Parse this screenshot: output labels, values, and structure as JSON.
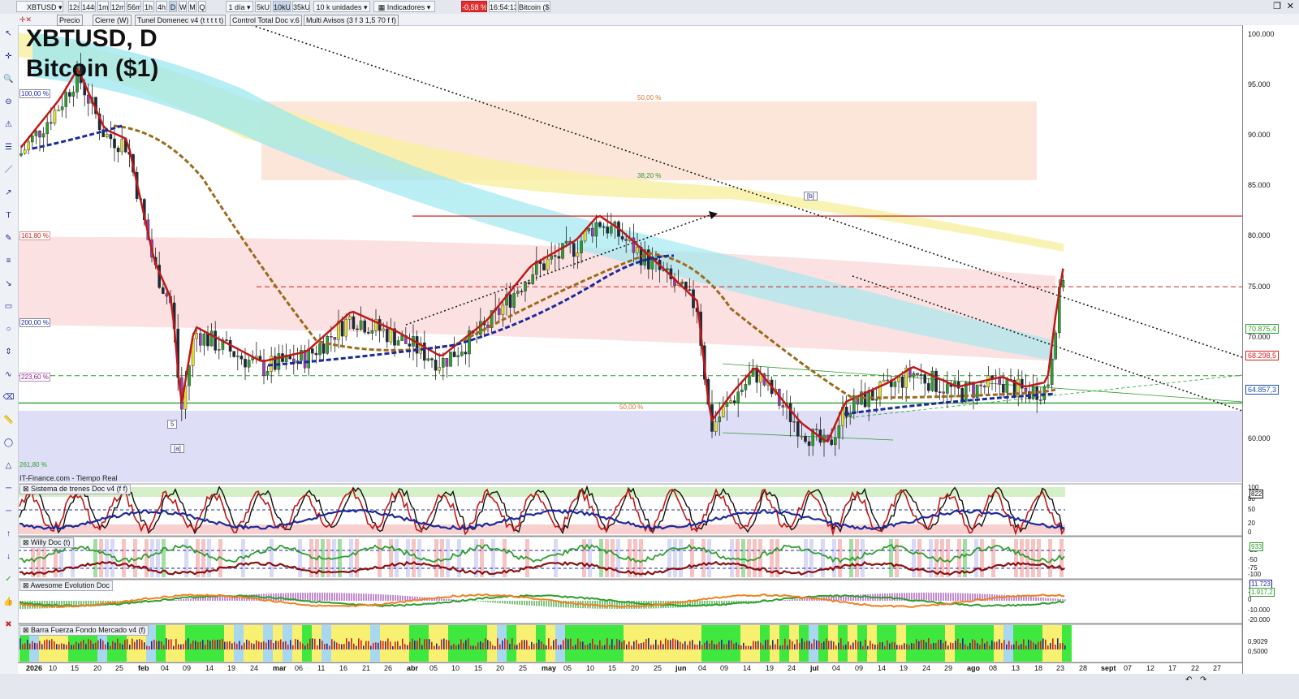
{
  "toolbar": {
    "symbol": "XBTUSD",
    "intervals": [
      "12s",
      "144s",
      "1m",
      "12m",
      "56m",
      "1h",
      "4h",
      "D",
      "W",
      "M",
      "Q"
    ],
    "selected_interval": "D",
    "range": "1 día",
    "units_buttons": [
      "5kU",
      "10kU",
      "35kU"
    ],
    "selected_units": "10kU",
    "units_select": "10 k unidades",
    "indicators_label": "Indicadores",
    "change": "-0,58 %",
    "time": "16:54:13",
    "instrument": "Bitcoin ($1)",
    "accent_negative": "#e03030"
  },
  "indicator_bar": {
    "items": [
      "Precio",
      "Cierre (W)",
      "Tunel Domenec v4 (t t t t t)",
      "Control Total Doc v.6",
      "Multi Avisos (3 f 3 1,5 70 f f)"
    ]
  },
  "chart_title": {
    "line1": "XBTUSD, D",
    "line2": "Bitcoin ($1)"
  },
  "source_label": "IT-Finance.com - Tiempo Real",
  "annotations": {
    "fib_labels": [
      "100,00 %",
      "161,80 %",
      "200,00 %",
      "223,60 %",
      "261,80 %",
      "50,00 %",
      "38,20 %",
      "50,00 %"
    ],
    "wave_labels": [
      "5",
      "[a]",
      "[b]"
    ]
  },
  "price_axis": {
    "ticks": [
      "100.000",
      "95.000",
      "90.000",
      "85.000",
      "80.000",
      "75.000",
      "70.000",
      "65.000",
      "60.000"
    ],
    "markers": [
      {
        "label": "70.875,4",
        "color": "#2e9e2e"
      },
      {
        "label": "68.298,5",
        "color": "#d02020"
      },
      {
        "label": "64.857,3",
        "color": "#2050b0"
      }
    ]
  },
  "panels": [
    {
      "title": "Sistema de trenes Doc v4 (f f)",
      "ticks": [
        "100",
        "80",
        "50",
        "20",
        "0"
      ],
      "marker": "822"
    },
    {
      "title": "Willy Doc (t)",
      "ticks": [
        "-25",
        "-50",
        "-75",
        "-100"
      ],
      "marker": "933"
    },
    {
      "title": "Awesome Evolution Doc",
      "ticks": [
        "10.000",
        "0",
        "-10.000",
        "-20.000"
      ],
      "markers": [
        "11.723",
        "1.917,2"
      ]
    },
    {
      "title": "Barra Fuerza Fondo Mercado v4 (f)",
      "ticks": [
        "0,9029",
        "0,5000"
      ]
    }
  ],
  "time_axis": [
    "2026",
    "10",
    "15",
    "20",
    "25",
    "feb",
    "04",
    "09",
    "14",
    "19",
    "24",
    "mar",
    "06",
    "11",
    "16",
    "21",
    "26",
    "abr",
    "05",
    "10",
    "15",
    "20",
    "25",
    "may",
    "05",
    "10",
    "15",
    "20",
    "25",
    "jun",
    "04",
    "09",
    "14",
    "19",
    "24",
    "jul",
    "04",
    "09",
    "14",
    "19",
    "24",
    "29",
    "ago",
    "08",
    "13",
    "18",
    "23",
    "28",
    "sept",
    "07",
    "12",
    "17",
    "22",
    "27"
  ],
  "colors": {
    "up": "#2e9e2e",
    "down": "#c01818",
    "fib_pink": "#f8c8c8",
    "cloud_cyan": "#9ee8f0",
    "cloud_yellow": "#f8f0a0",
    "support_blue": "#d8d8f4"
  },
  "chart_data": {
    "type": "candlestick",
    "title": "XBTUSD, D",
    "subtitle": "Bitcoin ($1)",
    "ylim": [
      55000,
      103000
    ],
    "x_range": [
      "2026-01-01",
      "2026-09-30"
    ],
    "close_path": [
      {
        "date": "2026-01-01",
        "close": 88000
      },
      {
        "date": "2026-01-10",
        "close": 93000
      },
      {
        "date": "2026-01-14",
        "close": 96000
      },
      {
        "date": "2026-01-20",
        "close": 90000
      },
      {
        "date": "2026-01-25",
        "close": 89000
      },
      {
        "date": "2026-01-31",
        "close": 77000
      },
      {
        "date": "2026-02-04",
        "close": 73000
      },
      {
        "date": "2026-02-06",
        "close": 62500
      },
      {
        "date": "2026-02-09",
        "close": 70500
      },
      {
        "date": "2026-02-24",
        "close": 67000
      },
      {
        "date": "2026-03-06",
        "close": 68000
      },
      {
        "date": "2026-03-16",
        "close": 72000
      },
      {
        "date": "2026-03-26",
        "close": 70000
      },
      {
        "date": "2026-04-05",
        "close": 67500
      },
      {
        "date": "2026-04-15",
        "close": 71000
      },
      {
        "date": "2026-04-25",
        "close": 76500
      },
      {
        "date": "2026-05-05",
        "close": 79000
      },
      {
        "date": "2026-05-10",
        "close": 81500
      },
      {
        "date": "2026-05-15",
        "close": 80000
      },
      {
        "date": "2026-05-25",
        "close": 76000
      },
      {
        "date": "2026-06-01",
        "close": 73000
      },
      {
        "date": "2026-06-04",
        "close": 61000
      },
      {
        "date": "2026-06-09",
        "close": 64000
      },
      {
        "date": "2026-06-14",
        "close": 66500
      },
      {
        "date": "2026-06-24",
        "close": 61000
      },
      {
        "date": "2026-06-30",
        "close": 59000
      },
      {
        "date": "2026-07-04",
        "close": 63000
      },
      {
        "date": "2026-07-14",
        "close": 65000
      },
      {
        "date": "2026-07-19",
        "close": 66500
      },
      {
        "date": "2026-07-29",
        "close": 64500
      },
      {
        "date": "2026-08-08",
        "close": 65500
      },
      {
        "date": "2026-08-13",
        "close": 64500
      },
      {
        "date": "2026-08-18",
        "close": 65000
      },
      {
        "date": "2026-08-20",
        "close": 72000
      },
      {
        "date": "2026-08-22",
        "close": 77500
      }
    ],
    "levels": [
      {
        "price": 82000,
        "style": "solid",
        "color": "#d02020"
      },
      {
        "price": 75000,
        "style": "dashed",
        "color": "#d02020"
      },
      {
        "price": 63500,
        "style": "solid",
        "color": "#2e9e2e"
      },
      {
        "price": 66200,
        "style": "dashed",
        "color": "#2e9e2e"
      }
    ]
  }
}
